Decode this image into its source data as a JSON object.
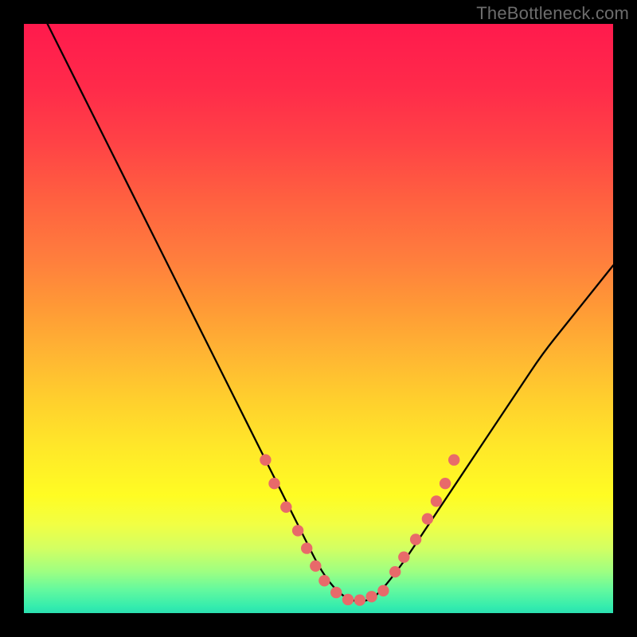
{
  "watermark": "TheBottleneck.com",
  "chart_data": {
    "type": "line",
    "title": "",
    "xlabel": "",
    "ylabel": "",
    "xlim": [
      0,
      100
    ],
    "ylim": [
      0,
      100
    ],
    "grid": false,
    "legend": false,
    "series": [
      {
        "name": "bottleneck-curve",
        "color": "#000000",
        "x": [
          4,
          8,
          12,
          16,
          20,
          24,
          28,
          32,
          36,
          40,
          42,
          44,
          46,
          48,
          50,
          52,
          54,
          56,
          58,
          60,
          64,
          68,
          72,
          76,
          80,
          84,
          88,
          92,
          96,
          100
        ],
        "y": [
          100,
          92,
          84,
          76,
          68,
          60,
          52,
          44,
          36,
          28,
          24,
          20,
          16,
          12,
          8,
          5,
          3,
          2,
          2,
          3,
          8,
          14,
          20,
          26,
          32,
          38,
          44,
          49,
          54,
          59
        ]
      }
    ],
    "markers": [
      {
        "x": 41,
        "y": 26
      },
      {
        "x": 42.5,
        "y": 22
      },
      {
        "x": 44.5,
        "y": 18
      },
      {
        "x": 46.5,
        "y": 14
      },
      {
        "x": 48,
        "y": 11
      },
      {
        "x": 49.5,
        "y": 8
      },
      {
        "x": 51,
        "y": 5.5
      },
      {
        "x": 53,
        "y": 3.5
      },
      {
        "x": 55,
        "y": 2.3
      },
      {
        "x": 57,
        "y": 2.2
      },
      {
        "x": 59,
        "y": 2.8
      },
      {
        "x": 61,
        "y": 3.8
      },
      {
        "x": 63,
        "y": 7
      },
      {
        "x": 64.5,
        "y": 9.5
      },
      {
        "x": 66.5,
        "y": 12.5
      },
      {
        "x": 68.5,
        "y": 16
      },
      {
        "x": 70,
        "y": 19
      },
      {
        "x": 71.5,
        "y": 22
      },
      {
        "x": 73,
        "y": 26
      }
    ],
    "marker_color": "#e86a6a",
    "background_gradient": {
      "top": "#ff1a4d",
      "middle": "#ffe829",
      "bottom": "#2cdfb0"
    }
  }
}
